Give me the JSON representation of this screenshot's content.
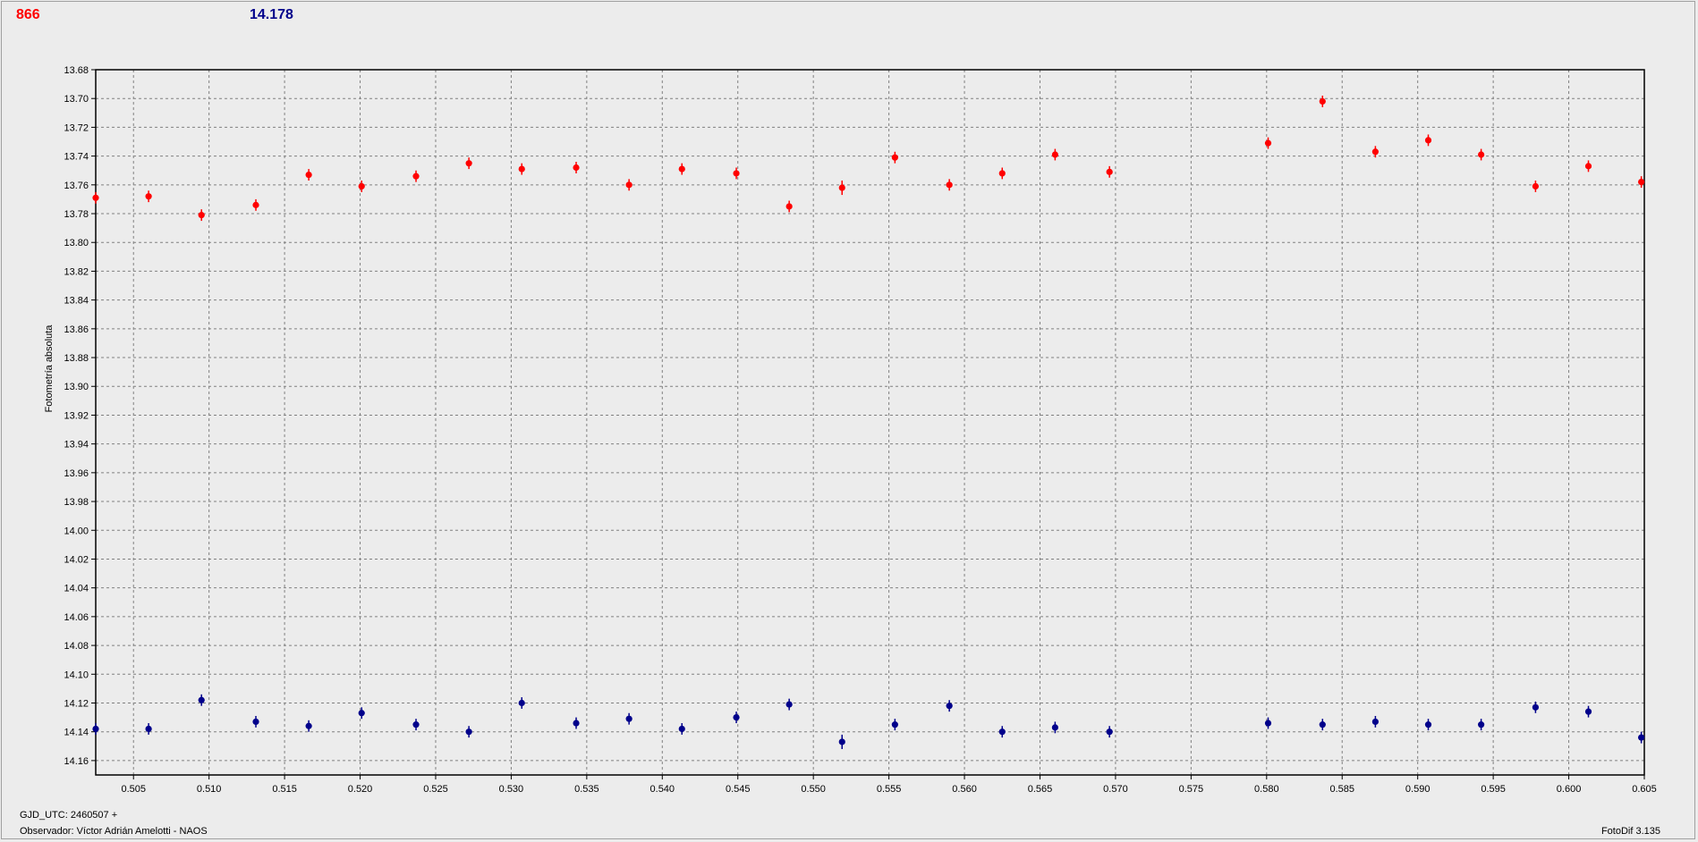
{
  "header": {
    "left_value": "866",
    "right_value": "14.178"
  },
  "footer": {
    "epoch": "GJD_UTC: 2460507 +",
    "observer": "Observador: Víctor Adrián Amelotti - NAOS",
    "software": "FotoDif 3.135"
  },
  "colors": {
    "series_a": "#ff0000",
    "series_b": "#00008b",
    "grid": "#808080",
    "plot_bg": "#ececec"
  },
  "chart_data": {
    "type": "scatter",
    "title": "",
    "xlabel": "",
    "ylabel": "Fotometría absoluta",
    "xlim": [
      0.5025,
      0.605
    ],
    "ylim": [
      13.68,
      14.17
    ],
    "y_inverted": true,
    "grid": true,
    "x_ticks": [
      "0.505",
      "0.510",
      "0.515",
      "0.520",
      "0.525",
      "0.530",
      "0.535",
      "0.540",
      "0.545",
      "0.550",
      "0.555",
      "0.560",
      "0.565",
      "0.570",
      "0.575",
      "0.580",
      "0.585",
      "0.590",
      "0.595",
      "0.600",
      "0.605"
    ],
    "y_ticks": [
      "13.68",
      "13.70",
      "13.72",
      "13.74",
      "13.76",
      "13.78",
      "13.80",
      "13.82",
      "13.84",
      "13.86",
      "13.88",
      "13.90",
      "13.92",
      "13.94",
      "13.96",
      "13.98",
      "14.00",
      "14.02",
      "14.04",
      "14.06",
      "14.08",
      "14.10",
      "14.12",
      "14.14",
      "14.16"
    ],
    "series": [
      {
        "color": "#ff0000",
        "points": [
          [
            0.5025,
            13.769,
            0.004
          ],
          [
            0.506,
            13.768,
            0.004
          ],
          [
            0.5095,
            13.781,
            0.004
          ],
          [
            0.5131,
            13.774,
            0.004
          ],
          [
            0.5166,
            13.753,
            0.004
          ],
          [
            0.5201,
            13.761,
            0.004
          ],
          [
            0.5237,
            13.754,
            0.004
          ],
          [
            0.5272,
            13.745,
            0.004
          ],
          [
            0.5307,
            13.749,
            0.004
          ],
          [
            0.5343,
            13.748,
            0.004
          ],
          [
            0.5378,
            13.76,
            0.004
          ],
          [
            0.5413,
            13.749,
            0.004
          ],
          [
            0.5449,
            13.752,
            0.004
          ],
          [
            0.5484,
            13.775,
            0.004
          ],
          [
            0.5519,
            13.762,
            0.005
          ],
          [
            0.5554,
            13.741,
            0.004
          ],
          [
            0.559,
            13.76,
            0.004
          ],
          [
            0.5625,
            13.752,
            0.004
          ],
          [
            0.566,
            13.739,
            0.004
          ],
          [
            0.5696,
            13.751,
            0.004
          ],
          [
            0.5801,
            13.731,
            0.004
          ],
          [
            0.5837,
            13.702,
            0.004
          ],
          [
            0.5872,
            13.737,
            0.004
          ],
          [
            0.5907,
            13.729,
            0.004
          ],
          [
            0.5942,
            13.739,
            0.004
          ],
          [
            0.5978,
            13.761,
            0.004
          ],
          [
            0.6013,
            13.747,
            0.004
          ],
          [
            0.6048,
            13.758,
            0.004
          ]
        ]
      },
      {
        "color": "#00008b",
        "points": [
          [
            0.5025,
            14.138,
            0.004
          ],
          [
            0.506,
            14.138,
            0.004
          ],
          [
            0.5095,
            14.118,
            0.004
          ],
          [
            0.5131,
            14.133,
            0.004
          ],
          [
            0.5166,
            14.136,
            0.004
          ],
          [
            0.5201,
            14.127,
            0.004
          ],
          [
            0.5237,
            14.135,
            0.004
          ],
          [
            0.5272,
            14.14,
            0.004
          ],
          [
            0.5307,
            14.12,
            0.004
          ],
          [
            0.5343,
            14.134,
            0.004
          ],
          [
            0.5378,
            14.131,
            0.004
          ],
          [
            0.5413,
            14.138,
            0.004
          ],
          [
            0.5449,
            14.13,
            0.004
          ],
          [
            0.5484,
            14.121,
            0.004
          ],
          [
            0.5519,
            14.147,
            0.005
          ],
          [
            0.5554,
            14.135,
            0.004
          ],
          [
            0.559,
            14.122,
            0.004
          ],
          [
            0.5625,
            14.14,
            0.004
          ],
          [
            0.566,
            14.137,
            0.004
          ],
          [
            0.5696,
            14.14,
            0.004
          ],
          [
            0.5801,
            14.134,
            0.004
          ],
          [
            0.5837,
            14.135,
            0.004
          ],
          [
            0.5872,
            14.133,
            0.004
          ],
          [
            0.5907,
            14.135,
            0.004
          ],
          [
            0.5942,
            14.135,
            0.004
          ],
          [
            0.5978,
            14.123,
            0.004
          ],
          [
            0.6013,
            14.126,
            0.004
          ],
          [
            0.6048,
            14.144,
            0.004
          ]
        ]
      }
    ]
  }
}
